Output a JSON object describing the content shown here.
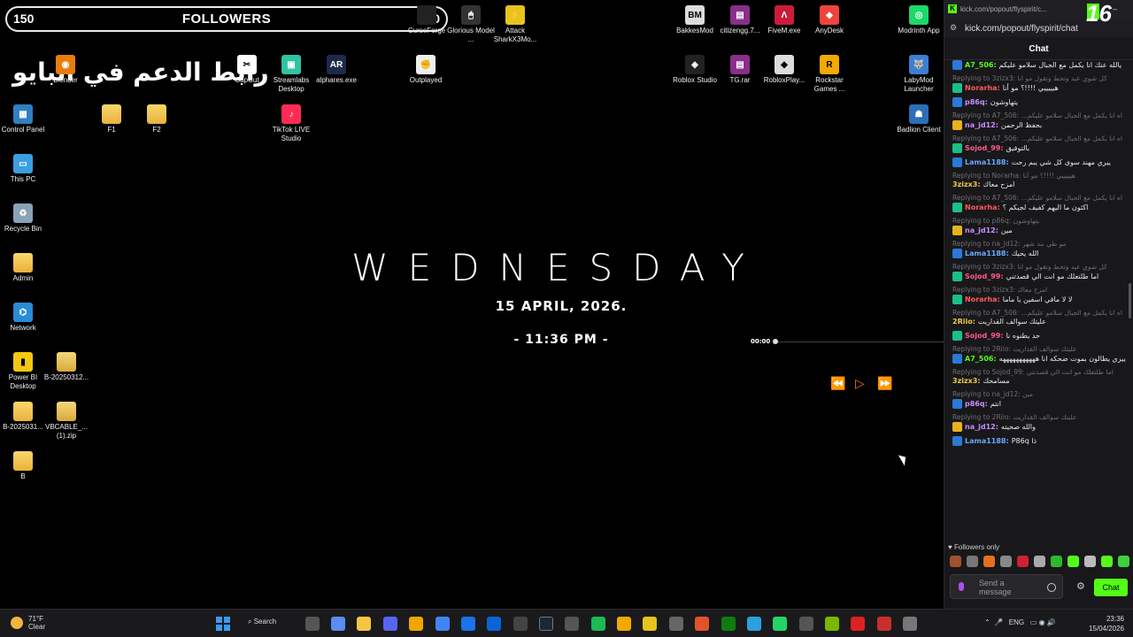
{
  "overlay": {
    "followers_current": "150",
    "followers_label": "FOLLOWERS",
    "followers_goal": "200",
    "arabic_banner": "رابط الدعم في البايو"
  },
  "desktop_icons": [
    {
      "label": "Control Panel",
      "icon": "control-panel-icon"
    },
    {
      "label": "This PC",
      "icon": "pc-icon"
    },
    {
      "label": "Recycle Bin",
      "icon": "recycle-bin-icon"
    },
    {
      "label": "Admin",
      "icon": "folder-icon"
    },
    {
      "label": "Network",
      "icon": "network-icon"
    },
    {
      "label": "Power BI Desktop",
      "icon": "powerbi-icon"
    },
    {
      "label": "B-2025031...",
      "icon": "folder-icon"
    },
    {
      "label": "B",
      "icon": "folder-icon"
    },
    {
      "label": "Blender",
      "icon": "blender-icon"
    },
    {
      "label": "F1",
      "icon": "folder-icon"
    },
    {
      "label": "F2",
      "icon": "folder-icon"
    },
    {
      "label": "B-20250312...",
      "icon": "zip-icon"
    },
    {
      "label": "VBCABLE_... (1).zip",
      "icon": "zip-icon"
    },
    {
      "label": "CapCut",
      "icon": "capcut-icon"
    },
    {
      "label": "Streamlabs Desktop",
      "icon": "streamlabs-icon"
    },
    {
      "label": "alphares.exe",
      "icon": "alphares-icon"
    },
    {
      "label": "TikTok LIVE Studio",
      "icon": "tiktok-icon"
    },
    {
      "label": "Outplayed",
      "icon": "outplayed-icon"
    },
    {
      "label": "Glorious Model ...",
      "icon": "glorious-icon"
    },
    {
      "label": "Attack SharkX3Mo...",
      "icon": "attackshark-icon"
    },
    {
      "label": "BakkesMod",
      "icon": "bakkesmod-icon"
    },
    {
      "label": "citizengg.7...",
      "icon": "winrar-icon"
    },
    {
      "label": "FiveM.exe",
      "icon": "fivem-icon"
    },
    {
      "label": "AnyDesk",
      "icon": "anydesk-icon"
    },
    {
      "label": "Roblox Studio",
      "icon": "roblox-studio-icon"
    },
    {
      "label": "TG.rar",
      "icon": "winrar-icon"
    },
    {
      "label": "RobloxPlay...",
      "icon": "roblox-icon"
    },
    {
      "label": "Rockstar Games ...",
      "icon": "rockstar-icon"
    },
    {
      "label": "Modrinth App",
      "icon": "modrinth-icon"
    },
    {
      "label": "LabyMod Launcher",
      "icon": "labymod-icon"
    },
    {
      "label": "Badlion Client",
      "icon": "badlion-icon"
    },
    {
      "label": "CurseForge",
      "icon": "curseforge-icon"
    }
  ],
  "clock_widget": {
    "day": "WEDNESDAY",
    "date": "15  APRIL, 2026.",
    "time": "- 11:36 PM -"
  },
  "media": {
    "elapsed": "00:00",
    "prev": "⏪",
    "play": "▷",
    "next": "⏩"
  },
  "chat": {
    "window_title": "kick.com/popout/flyspirit/c...",
    "url": "kick.com/popout/flyspirit/chat",
    "header": "Chat",
    "messages": [
      {
        "reply": "",
        "user": "A7_506",
        "color": "#53fc18",
        "badge": "#2b79d8",
        "text": "يالله عنك انا يكمل مع الجبال سلامو عليكم"
      },
      {
        "reply": "Replying to 3zizx3: كل شوي عيد وتحط وتقول مو انا",
        "user": "Norarha",
        "color": "#ff5a5a",
        "badge": "#1cbf86",
        "text": "هيييييي !!!!؟ مو أنا"
      },
      {
        "reply": "",
        "user": "p86q",
        "color": "#c88cff",
        "badge": "#2b79d8",
        "text": "يتهاوشون"
      },
      {
        "reply": "Replying to A7_506: ...اه انا يكمل مع الجبال سلامو عليكم",
        "user": "na_jd12",
        "color": "#c88cff",
        "badge": "#e8b21f",
        "text": "بحفظ الرحمن"
      },
      {
        "reply": "Replying to A7_506: ...اه انا يكمل مع الجبال سلامو عليكم",
        "user": "Sojod_99",
        "color": "#ff5a8a",
        "badge": "#1cbf86",
        "text": "بالتوفيق"
      },
      {
        "reply": "",
        "user": "Lama1188",
        "color": "#6aa8ff",
        "badge": "#2b79d8",
        "text": "ييري مهند سوى كل شي يبم رحت"
      },
      {
        "reply": "Replying to Norarha: هيييييي !!!!؟ مو أنا",
        "user": "3zizx3",
        "color": "#f2c94c",
        "badge": "",
        "text": "امزح معاك"
      },
      {
        "reply": "Replying to A7_506: ...اه انا يكمل مع الجبال سلامو عليكم",
        "user": "Norarha",
        "color": "#ff5a5a",
        "badge": "#1cbf86",
        "text": "اكثون ما اليهم كفيف لجيكم ؟"
      },
      {
        "reply": "Replying to p86q: يتهاوشون",
        "user": "na_jd12",
        "color": "#c88cff",
        "badge": "#e8b21f",
        "text": "مين"
      },
      {
        "reply": "Replying to na_jd12: مو طي بند شهر",
        "user": "Lama1188",
        "color": "#6aa8ff",
        "badge": "#2b79d8",
        "text": "الله يحيك"
      },
      {
        "reply": "Replying to 3zizx3: كل شوي عيد وتحط وتقول مو انا",
        "user": "Sojod_99",
        "color": "#ff5a8a",
        "badge": "#1cbf86",
        "text": "اما طلتعلك مو انت الي قصدتني"
      },
      {
        "reply": "Replying to 3zizx3: امزح معاك",
        "user": "Norarha",
        "color": "#ff5a5a",
        "badge": "#1cbf86",
        "text": "لا لا مافي اسفين يا ماما"
      },
      {
        "reply": "Replying to A7_506: ...اه انا يكمل مع الجبال سلامو عليكم",
        "user": "2Riio",
        "color": "#f2c94c",
        "badge": "",
        "text": "عليتك سوالف القداريت"
      },
      {
        "reply": "",
        "user": "Sojod_99",
        "color": "#ff5a8a",
        "badge": "#1cbf86",
        "text": "حد يطنوه نا"
      },
      {
        "reply": "Replying to 2Riio: عليتك سوالف القداريت",
        "user": "A7_506",
        "color": "#53fc18",
        "badge": "#2b79d8",
        "text": "ييري يطالون بموت ضحكه انا هههههههههههه"
      },
      {
        "reply": "Replying to Sojod_99: اما طلتعلك مو انت الي قصدتني",
        "user": "3zizx3",
        "color": "#f2c94c",
        "badge": "",
        "text": "مسامحك"
      },
      {
        "reply": "Replying to na_jd12: مين",
        "user": "p86q",
        "color": "#c88cff",
        "badge": "#2b79d8",
        "text": "انتم"
      },
      {
        "reply": "Replying to 2Riio: عليتك سوالف القداريت",
        "user": "na_jd12",
        "color": "#c88cff",
        "badge": "#e8b21f",
        "text": "والله صحيته"
      },
      {
        "reply": "",
        "user": "Lama1188",
        "color": "#6aa8ff",
        "badge": "#2b79d8",
        "text": "P86q ذا"
      }
    ],
    "followers_only": "Followers only",
    "input_placeholder": "Send a message",
    "send_label": "Chat"
  },
  "taskbar": {
    "weather_temp": "71°F",
    "weather_desc": "Clear",
    "search_label": "Search",
    "language": "ENG",
    "time": "23:36",
    "date": "15/04/2026"
  }
}
